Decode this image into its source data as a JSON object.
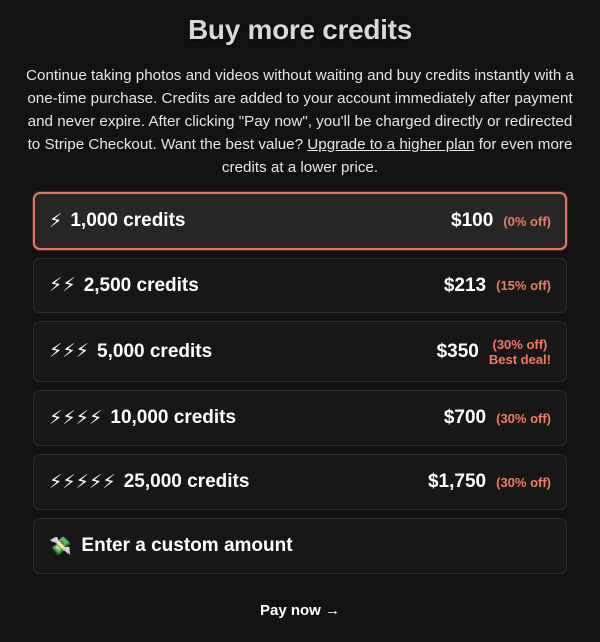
{
  "header": {
    "title": "Buy more credits"
  },
  "description": {
    "text_before": "Continue taking photos and videos without waiting and buy credits instantly with a one-time purchase. Credits are added to your account immediately after payment and never expire. After clicking \"Pay now\", you'll be charged directly or redirected to Stripe Checkout. Want the best value? ",
    "link": "Upgrade to a higher plan",
    "text_after": " for even more credits at a lower price."
  },
  "options": [
    {
      "bolt": "⚡",
      "credits": "1,000 credits",
      "price": "$100",
      "discount": "(0% off)",
      "selected": true
    },
    {
      "bolt": "⚡⚡",
      "credits": "2,500 credits",
      "price": "$213",
      "discount": "(15% off)"
    },
    {
      "bolt": "⚡⚡⚡",
      "credits": "5,000 credits",
      "price": "$350",
      "discount": "(30% off)",
      "note": "Best deal!"
    },
    {
      "bolt": "⚡⚡⚡⚡",
      "credits": "10,000 credits",
      "price": "$700",
      "discount": "(30% off)"
    },
    {
      "bolt": "⚡⚡⚡⚡⚡",
      "credits": "25,000 credits",
      "price": "$1,750",
      "discount": "(30% off)"
    }
  ],
  "custom": {
    "icon": "💸",
    "label": "Enter a custom amount"
  },
  "pay": {
    "label": "Pay now →"
  }
}
